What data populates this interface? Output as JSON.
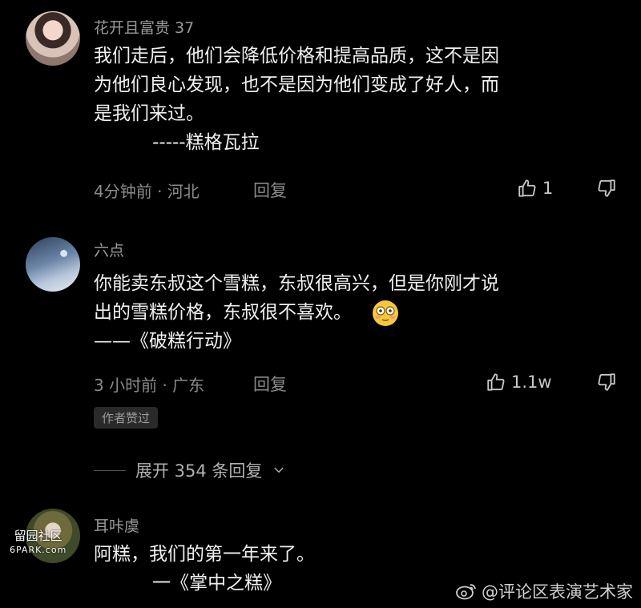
{
  "comments": [
    {
      "username": "花开且富贵 37",
      "lines": [
        "我们走后，他们会降低价格和提高品质，这不是因",
        "为他们良心发现，也不是因为他们变成了好人，而",
        "是我们来过。",
        "          -----糕格瓦拉"
      ],
      "time_location": "4分钟前 · 河北",
      "reply_label": "回复",
      "like_count": "1"
    },
    {
      "username": "六点",
      "lines": [
        "你能卖东叔这个雪糕，东叔很高兴，但是你刚才说",
        "出的雪糕价格，东叔很不喜欢。",
        "——《破糕行动》"
      ],
      "emoji": "😳",
      "time_location": "3 小时前 · 广东",
      "reply_label": "回复",
      "like_count": "1.1w",
      "badge": "作者赞过"
    },
    {
      "username": "耳咔虞",
      "lines": [
        "阿糕，我们的第一年来了。",
        "          一《掌中之糕》"
      ]
    }
  ],
  "expand_label": "展开 354 条回复",
  "watermark_left": {
    "top": "留园社区",
    "bottom": "6PARK.com"
  },
  "watermark_right": "@评论区表演艺术家"
}
